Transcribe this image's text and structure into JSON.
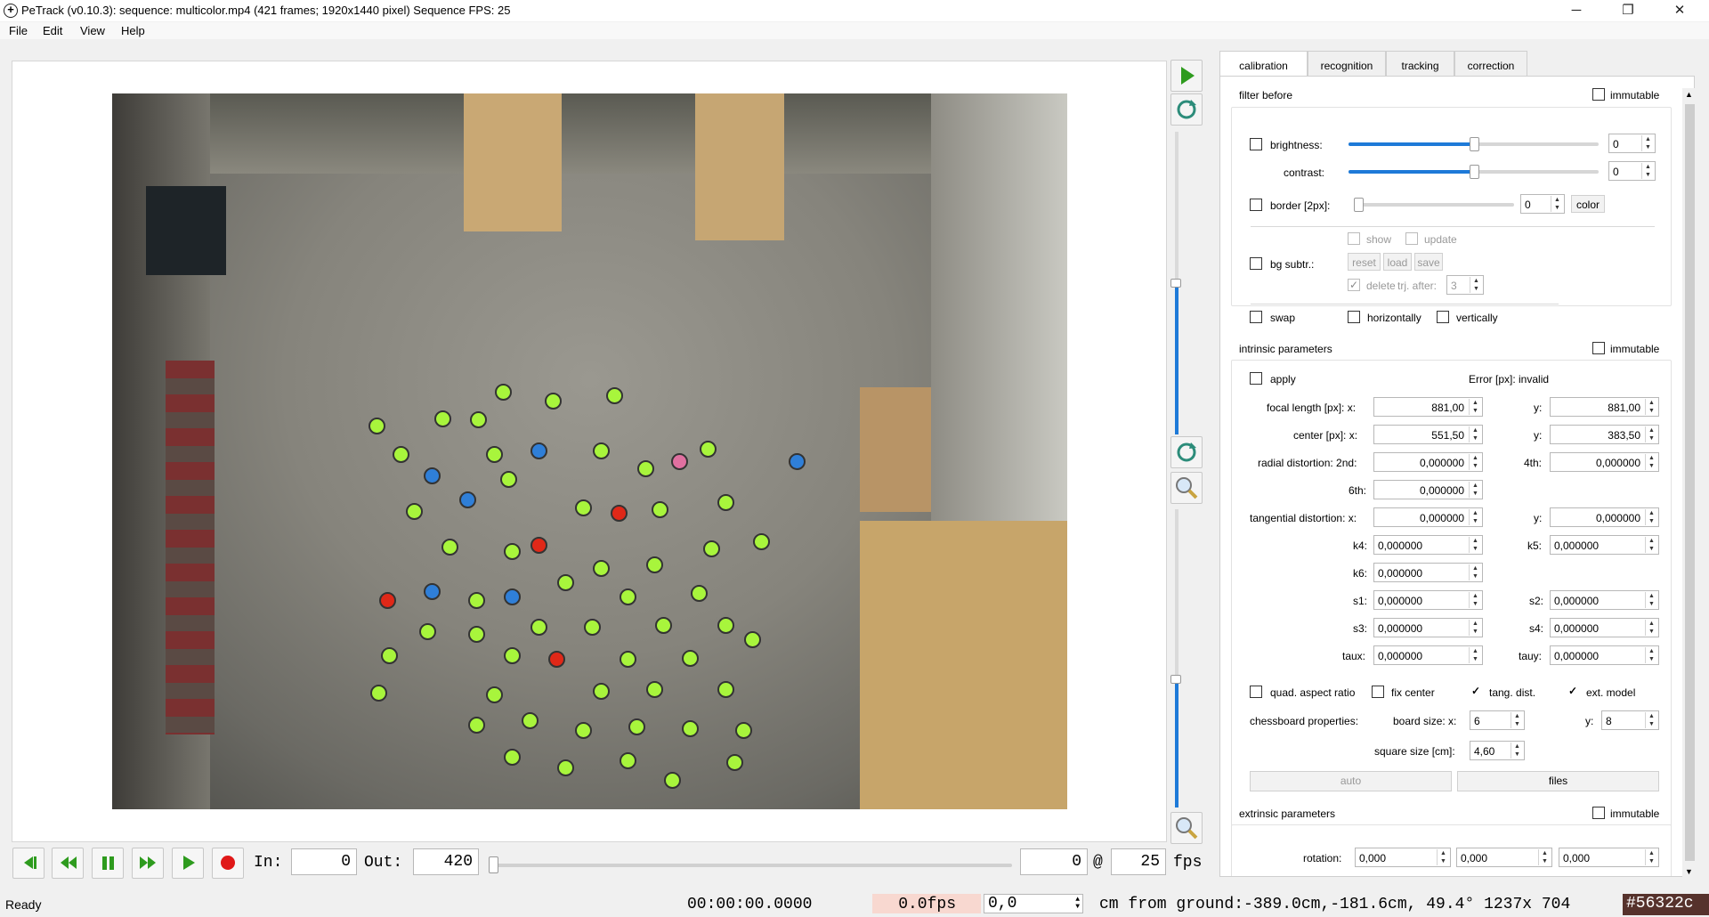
{
  "window": {
    "title": "PeTrack (v0.10.3): sequence: multicolor.mp4 (421 frames; 1920x1440 pixel) Sequence FPS: 25",
    "minimize": "─",
    "restore": "❐",
    "close": "✕"
  },
  "menu": [
    "File",
    "Edit",
    "View",
    "Help"
  ],
  "player": {
    "in_label": "In:",
    "in_value": "0",
    "out_label": "Out:",
    "out_value": "420",
    "frame": "0",
    "at": "@",
    "fps_value": "25",
    "fps_unit": "fps",
    "position_fraction": 0.0
  },
  "status": {
    "ready": "Ready",
    "time": "00:00:00.0000",
    "fps_readout": "0.0fps",
    "height_value": "0,0",
    "ground": "cm from ground:-389.0cm,-181.6cm, 49.4° 1237x 704",
    "color_code": "#56322c"
  },
  "tabs": [
    "calibration",
    "recognition",
    "tracking",
    "correction"
  ],
  "filter_before": {
    "heading": "filter before",
    "immutable": "immutable",
    "brightness_label": "brightness:",
    "brightness_value": "0",
    "brightness_level": 0.5,
    "contrast_label": "contrast:",
    "contrast_value": "0",
    "contrast_level": 0.5,
    "border_label": "border [2px]:",
    "border_value": "0",
    "color_btn": "color",
    "show": "show",
    "update": "update",
    "bg_subtr": "bg subtr.:",
    "reset": "reset",
    "load": "load",
    "save": "save",
    "delete": "delete",
    "trj_after": "trj. after:",
    "trj_after_value": "3",
    "swap": "swap",
    "horizontally": "horizontally",
    "vertically": "vertically"
  },
  "intrinsic": {
    "heading": "intrinsic parameters",
    "immutable": "immutable",
    "apply": "apply",
    "error": "Error [px]: invalid",
    "focal_label": "focal length [px]: x:",
    "focal_x": "881,00",
    "focal_y_label": "y:",
    "focal_y": "881,00",
    "center_label": "center [px]: x:",
    "center_x": "551,50",
    "center_y_label": "y:",
    "center_y": "383,50",
    "radial_label": "radial distortion: 2nd:",
    "radial_2nd": "0,000000",
    "radial_4th_label": "4th:",
    "radial_4th": "0,000000",
    "radial_6th_label": "6th:",
    "radial_6th": "0,000000",
    "tangential_label": "tangential distortion: x:",
    "tangential_x": "0,000000",
    "tangential_y_label": "y:",
    "tangential_y": "0,000000",
    "k4_label": "k4:",
    "k4": "0,000000",
    "k5_label": "k5:",
    "k5": "0,000000",
    "k6_label": "k6:",
    "k6": "0,000000",
    "s1_label": "s1:",
    "s1": "0,000000",
    "s2_label": "s2:",
    "s2": "0,000000",
    "s3_label": "s3:",
    "s3": "0,000000",
    "s4_label": "s4:",
    "s4": "0,000000",
    "taux_label": "taux:",
    "taux": "0,000000",
    "tauy_label": "tauy:",
    "tauy": "0,000000",
    "quad_aspect": "quad. aspect ratio",
    "fix_center": "fix center",
    "tang_dist": "tang. dist.",
    "ext_model": "ext. model",
    "chess_label": "chessboard properties:",
    "board_label": "board size: x:",
    "board_x": "6",
    "board_y_label": "y:",
    "board_y": "8",
    "square_label": "square size [cm]:",
    "square_size": "4,60",
    "auto": "auto",
    "files": "files"
  },
  "extrinsic": {
    "heading": "extrinsic parameters",
    "immutable": "immutable",
    "rotation_label": "rotation:",
    "rot_1": "0,000",
    "rot_2": "0,000",
    "rot_3": "0,000"
  },
  "colors": {
    "accent": "#1e7ad8",
    "marker_green": "#a8f53c",
    "record_red": "#e01818",
    "play_green": "#2e9b1e"
  },
  "icons": {
    "play": "play-icon",
    "refresh": "refresh-icon",
    "zoom": "magnifier-icon"
  }
}
